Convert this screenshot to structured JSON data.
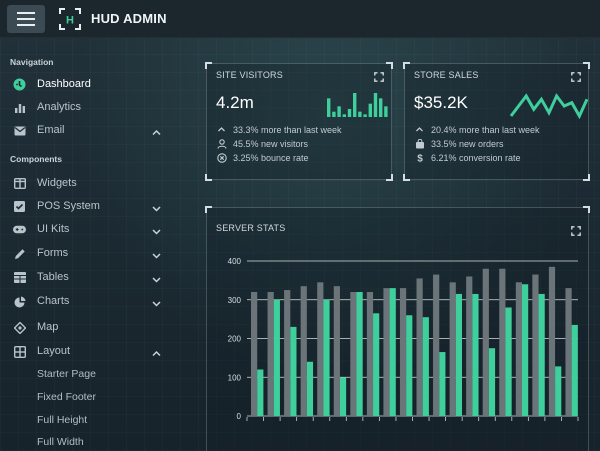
{
  "header": {
    "brand": "HUD ADMIN",
    "logo_letter": "H"
  },
  "sidebar": {
    "navigation_title": "Navigation",
    "components_title": "Components",
    "nav_items": [
      {
        "label": "Dashboard",
        "icon": "dashboard-icon",
        "active": true
      },
      {
        "label": "Analytics",
        "icon": "bar-chart-icon"
      },
      {
        "label": "Email",
        "icon": "envelope-icon",
        "chevron": "up"
      }
    ],
    "component_items": [
      {
        "label": "Widgets",
        "icon": "columns-icon"
      },
      {
        "label": "POS System",
        "icon": "check-box-icon",
        "chevron": "down"
      },
      {
        "label": "UI Kits",
        "icon": "gamepad-icon",
        "chevron": "down"
      },
      {
        "label": "Forms",
        "icon": "pen-icon",
        "chevron": "down"
      },
      {
        "label": "Tables",
        "icon": "table-icon",
        "chevron": "down"
      },
      {
        "label": "Charts",
        "icon": "pie-chart-icon",
        "chevron": "down"
      },
      {
        "label": "Map",
        "icon": "map-pin-icon"
      },
      {
        "label": "Layout",
        "icon": "layout-icon",
        "chevron": "up"
      }
    ],
    "layout_sub_items": [
      "Starter Page",
      "Fixed Footer",
      "Full Height",
      "Full Width"
    ]
  },
  "site_visitors": {
    "title": "SITE VISITORS",
    "value": "4.2m",
    "stats": [
      {
        "icon": "chevron-up-icon",
        "text": "33.3% more than last week"
      },
      {
        "icon": "user-icon",
        "text": "45.5% new visitors"
      },
      {
        "icon": "circle-x-icon",
        "text": "3.25% bounce rate"
      }
    ],
    "sparkline": [
      7,
      2,
      4,
      1,
      3,
      9,
      2,
      1,
      5,
      9,
      7,
      4
    ]
  },
  "store_sales": {
    "title": "STORE SALES",
    "value": "$35.2K",
    "stats": [
      {
        "icon": "chevron-up-icon",
        "text": "20.4% more than last week"
      },
      {
        "icon": "shopping-bag-icon",
        "text": "33.5% new orders"
      },
      {
        "icon": "dollar-icon",
        "text": "6.21% conversion rate"
      }
    ],
    "sparkline": [
      2,
      5,
      8,
      4,
      7,
      3,
      8,
      5,
      6,
      2,
      7
    ]
  },
  "server_stats": {
    "title": "SERVER STATS"
  },
  "colors": {
    "accent": "#3ecf9c",
    "bar_gray": "#6b7479",
    "bg": "#1c2a33"
  },
  "chart_data": {
    "type": "bar",
    "title": "SERVER STATS",
    "ylim": [
      0,
      400
    ],
    "yticks": [
      0,
      100,
      200,
      300,
      400
    ],
    "grid": true,
    "series": [
      {
        "values": [
          320,
          320,
          325,
          335,
          345,
          335,
          320,
          320,
          330,
          330,
          355,
          365,
          345,
          360,
          380,
          380,
          345,
          365,
          385,
          330
        ]
      },
      {
        "values": [
          120,
          300,
          230,
          140,
          300,
          100,
          320,
          265,
          330,
          260,
          255,
          165,
          315,
          315,
          175,
          280,
          340,
          315,
          128,
          235
        ]
      }
    ]
  }
}
